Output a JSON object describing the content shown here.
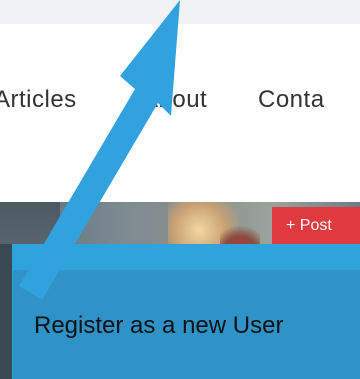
{
  "nav": {
    "articles": "Articles",
    "about": "About",
    "contact": "Conta"
  },
  "hero": {
    "post_button": "+ Post"
  },
  "tooltip": {
    "text": "Register as a new User"
  },
  "colors": {
    "arrow": "#31a2de",
    "tooltip": "#2f93c8",
    "post_button": "#e03a3f"
  },
  "icons": {
    "pointer": "arrow-icon"
  }
}
